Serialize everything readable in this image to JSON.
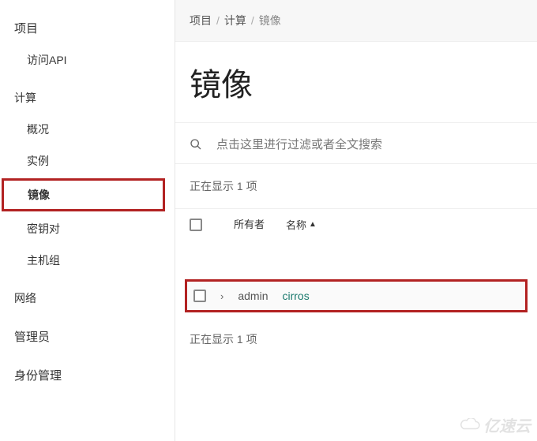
{
  "sidebar": {
    "project": "项目",
    "access_api": "访问API",
    "compute": "计算",
    "overview": "概况",
    "instances": "实例",
    "images": "镜像",
    "keypairs": "密钥对",
    "hostgroups": "主机组",
    "network": "网络",
    "admin": "管理员",
    "identity": "身份管理"
  },
  "breadcrumb": {
    "a": "项目",
    "b": "计算",
    "c": "镜像"
  },
  "page": {
    "title": "镜像",
    "search_placeholder": "点击这里进行过滤或者全文搜索",
    "count_top": "正在显示 1 项",
    "count_bottom": "正在显示 1 项"
  },
  "table": {
    "header_owner": "所有者",
    "header_name": "名称",
    "rows": [
      {
        "owner": "admin",
        "name": "cirros"
      }
    ]
  },
  "watermark": "亿速云"
}
